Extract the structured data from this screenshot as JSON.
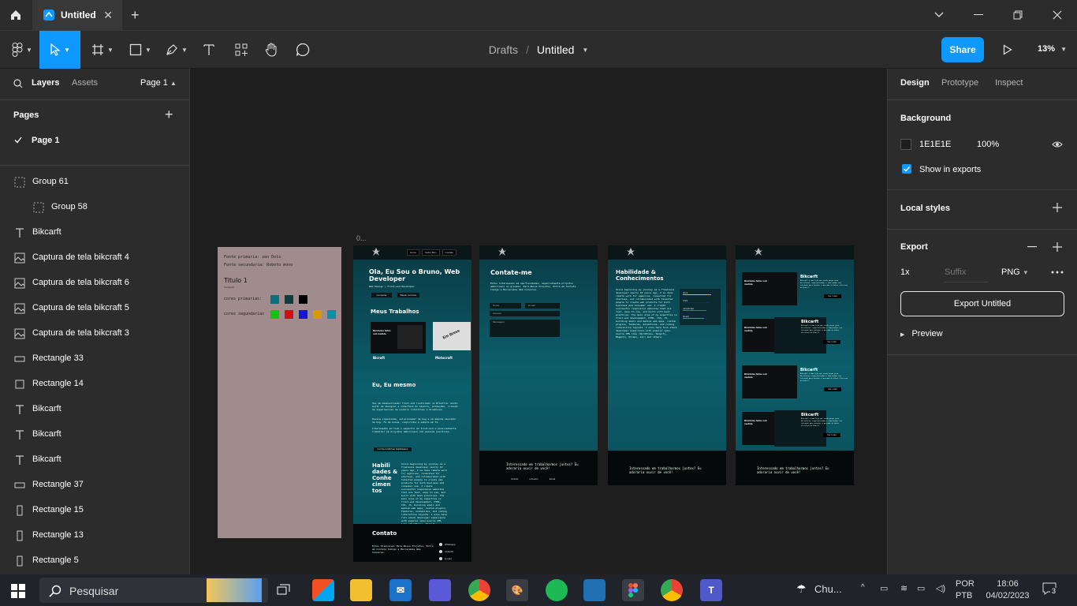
{
  "titlebar": {
    "tab_title": "Untitled",
    "tab_close": "✕",
    "new_tab": "+"
  },
  "toolbar": {
    "breadcrumb_parent": "Drafts",
    "breadcrumb_separator": "/",
    "file_name": "Untitled",
    "share_label": "Share",
    "zoom": "13%"
  },
  "left_panel": {
    "tab_layers": "Layers",
    "tab_assets": "Assets",
    "page_selector": "Page 1",
    "pages_heading": "Pages",
    "add_page": "+",
    "current_page": "Page 1",
    "layers": [
      {
        "name": "Group 61",
        "icon": "group"
      },
      {
        "name": "Group 58",
        "icon": "group"
      },
      {
        "name": "Bikcarft",
        "icon": "text"
      },
      {
        "name": "Captura de tela bikcraft 4",
        "icon": "image"
      },
      {
        "name": "Captura de tela bikcraft 6",
        "icon": "image"
      },
      {
        "name": "Captura de tela bikcraft 5",
        "icon": "image"
      },
      {
        "name": "Captura de tela bikcraft 3",
        "icon": "image"
      },
      {
        "name": "Rectangle 33",
        "icon": "rect-wide"
      },
      {
        "name": "Rectangle 14",
        "icon": "rect"
      },
      {
        "name": "Bikcarft",
        "icon": "text"
      },
      {
        "name": "Bikcarft",
        "icon": "text"
      },
      {
        "name": "Bikcarft",
        "icon": "text"
      },
      {
        "name": "Rectangle 37",
        "icon": "rect-wide"
      },
      {
        "name": "Rectangle 15",
        "icon": "rect-tall"
      },
      {
        "name": "Rectangle 13",
        "icon": "rect-tall"
      },
      {
        "name": "Rectangle 5",
        "icon": "rect-tall"
      }
    ]
  },
  "canvas": {
    "frame_label": "0...",
    "style_card": {
      "font_primary": "Fonte primaria: zen Dots",
      "font_secondary": "Fonte secundaria: Roboto mono",
      "heading": "Titulo 1",
      "sub": "Parágrafo",
      "primary_colors_label": "cores primarias:",
      "secondary_colors_label": "cores segundarias",
      "primary_colors": [
        "#0b6f80",
        "#0f3d3d",
        "#000000"
      ],
      "secondary_colors": [
        "#12c412",
        "#d01010",
        "#1515d6",
        "#d89a00",
        "#0b8fa6"
      ]
    },
    "home": {
      "nav": [
        "Home",
        "Sobre Mim",
        "Contato"
      ],
      "hero_title": "Ola, Eu Sou o Bruno, Web Developer",
      "hero_sub": "Web Design | Front-end Developer",
      "btn_contact": "Contactar",
      "btn_work": "Baixar curriculo",
      "works_heading": "Meus Trabalhos",
      "card1": "Bicraft",
      "card2": "Motocraft",
      "soon": "Em Breve",
      "about_heading": "Eu, Eu mesmo",
      "about_text_1": "Sou um desenvolvedor front-end localizado no Brasilia. Gosto muito de designer e interface do usuário, animações, criando de experiencias de usuário intuitivas e dinamicas.",
      "about_text_2": "Pessoa organizada, solucionador de bug e um amante saucador de bug. Fa de bossa, caipirinha e sempre em TI.",
      "about_text_3": "Interessado em todo o espectro de front-end e possivelmente trabalhar em projetos ambiciosos com pessoas positivas.",
      "about_btn": "Conheca Minhas Habilidades",
      "skills_heading": "Habili dades & Conhe cimen tos",
      "contact_heading": "Contato",
      "contact_text": "Estou Disponivel Para Novos Projetos, Entre em Contato Comigo e Marcaremos Uma Conversa.",
      "contact_items": [
        "Whatsapp",
        "LinkedIn",
        "E-mail"
      ]
    },
    "contact_page": {
      "heading": "Contate-me",
      "text": "Estou interessado em oportunidades, especialmente projetos ambiciosos ou grandes. Para Novos Projetos, Entre em Contato Comigo e Marcaremos Uma Conversa.",
      "fields": [
        "Nome",
        "E-mail",
        "Assunto",
        "Mensagem"
      ],
      "footer": "Interessado em trabalharmos juntos? Eu adoraria ouvir de você!",
      "footer_links": [
        "GitHub",
        "LinkedIn",
        "Email"
      ]
    },
    "skills_page": {
      "heading": "Habilidade & Conhecimentos",
      "text": "Since beginning my journey as a freelance developer nearly 10 years ago, I've done remote work for agencies, consulted for startups, and collaborated with talented people to create web products for both business and consumer use. I create successful responsive websites that are fast, easy to use, and built with best practices. The main area of my expertise is front-end development, HTML, CSS, JS, building small and medium web apps, custom plugins, features, animations, and coding interactive layouts. I also have full-stack developer experience with popular open-source CMS like (WordPress, Shopify, Magento, Strapi, etc) and others.",
      "bars": [
        "Html",
        "CSS",
        "JavaScript",
        "React"
      ],
      "footer": "Interessado em trabalharmos juntos? Eu adoraria ouvir de você!"
    },
    "projects_page": {
      "card_title": "Bikcarft",
      "card_text": "Bikcraft é uma loja que vende peças para bicicletas, especializadas e fabricadas com intenção para atender o mercado de bikes elétricas do Brasil.",
      "card_btn": "Ver mais",
      "shot_title": "Bicicletas feitas sob medida",
      "footer": "Interessado em trabalharmos juntos? Eu adoraria ouvir de você!"
    }
  },
  "right_panel": {
    "tabs": [
      "Design",
      "Prototype",
      "Inspect"
    ],
    "background_heading": "Background",
    "bg_hex": "1E1E1E",
    "bg_opacity": "100%",
    "show_in_exports": "Show in exports",
    "local_styles": "Local styles",
    "export_heading": "Export",
    "export_scale": "1x",
    "suffix_placeholder": "Suffix",
    "export_format": "PNG",
    "export_button": "Export Untitled",
    "preview": "Preview",
    "help": "?"
  },
  "taskbar": {
    "search_placeholder": "Pesquisar",
    "weather": "Chu...",
    "lang_1": "POR",
    "lang_2": "PTB",
    "time": "18:06",
    "date": "04/02/2023",
    "notification_count": "3"
  },
  "colors": {
    "accent": "#0d99ff",
    "panel": "#2c2c2c",
    "canvas": "#1e1e1e",
    "style_card": "#a08c8c",
    "portfolio_teal": "#0b5e6b"
  }
}
